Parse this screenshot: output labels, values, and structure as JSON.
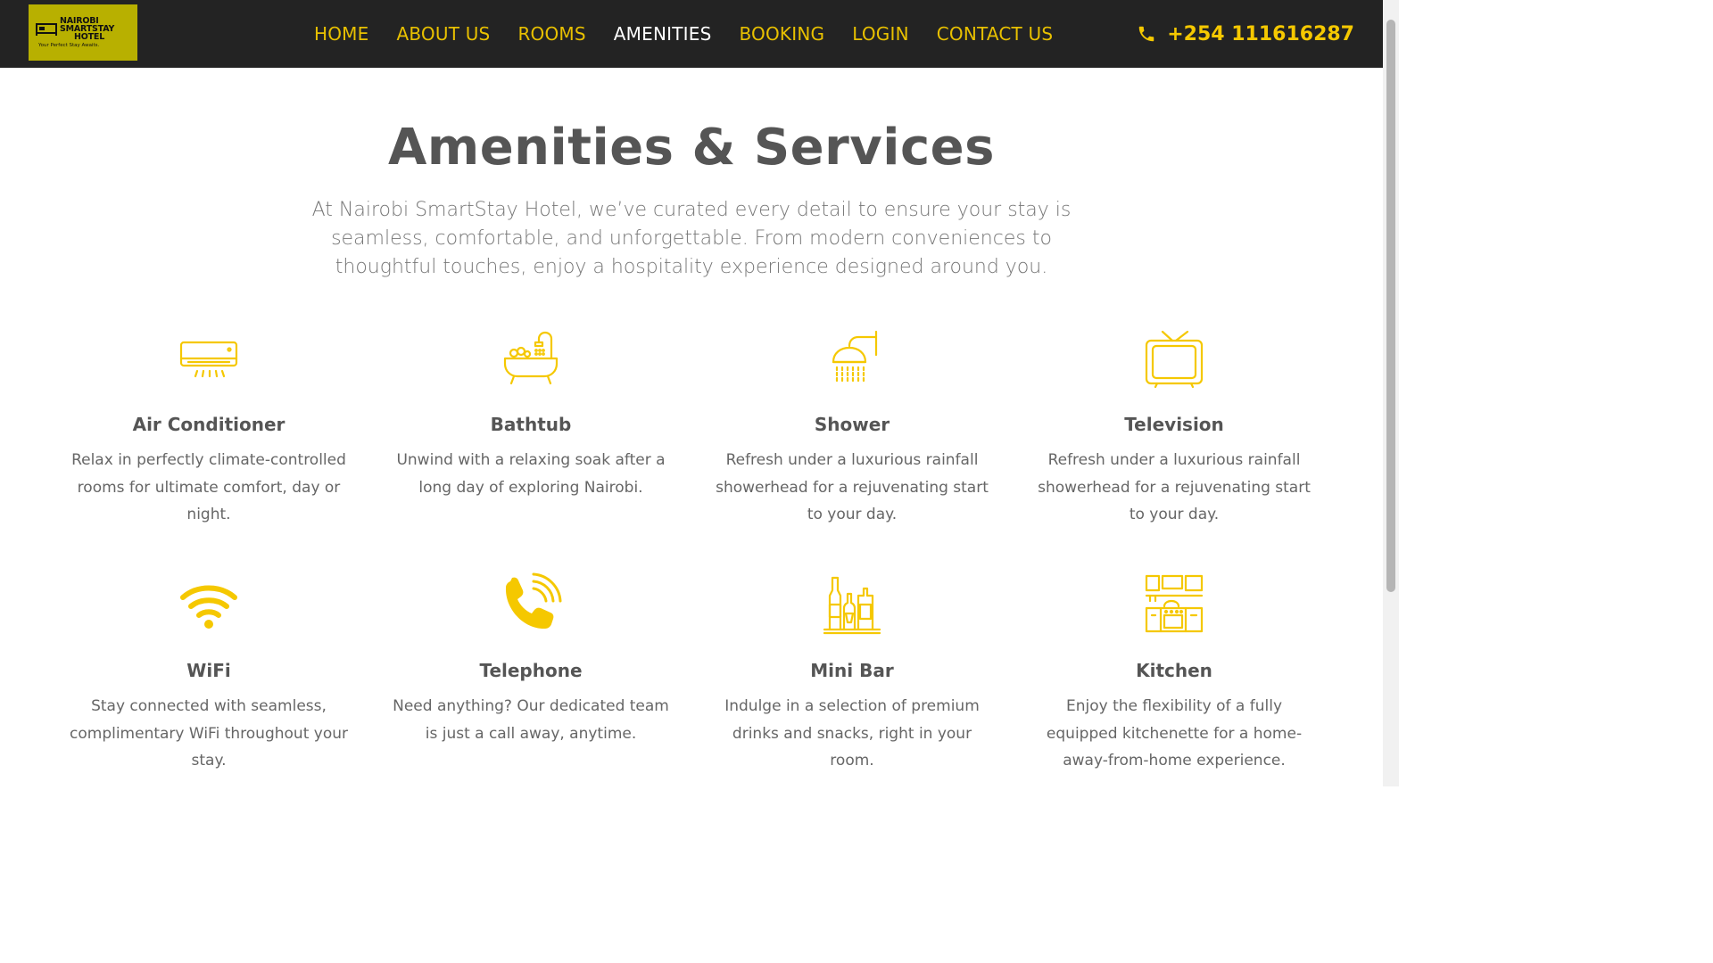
{
  "brand": {
    "line1": "NAIROBI",
    "line2": "SMARTSTAY",
    "line3": "HOTEL",
    "tagline": "Your Perfect Stay Awaits."
  },
  "nav": {
    "items": [
      {
        "label": "HOME"
      },
      {
        "label": "ABOUT US"
      },
      {
        "label": "ROOMS"
      },
      {
        "label": "AMENITIES",
        "active": true
      },
      {
        "label": "BOOKING"
      },
      {
        "label": "LOGIN"
      },
      {
        "label": "CONTACT US"
      }
    ],
    "phone": "+254 111616287"
  },
  "hero": {
    "title": "Amenities & Services",
    "intro": "At Nairobi SmartStay Hotel, we’ve curated every detail to ensure your stay is seamless, comfortable, and unforgettable. From modern conveniences to thoughtful touches, enjoy a hospitality experience designed around you."
  },
  "amenities": [
    {
      "name": "Air Conditioner",
      "icon": "air-conditioner-icon",
      "desc": "Relax in perfectly climate-controlled rooms for ultimate comfort, day or night."
    },
    {
      "name": "Bathtub",
      "icon": "bathtub-icon",
      "desc": "Unwind with a relaxing soak after a long day of exploring Nairobi."
    },
    {
      "name": "Shower",
      "icon": "shower-icon",
      "desc": "Refresh under a luxurious rainfall showerhead for a rejuvenating start to your day."
    },
    {
      "name": "Television",
      "icon": "television-icon",
      "desc": "Refresh under a luxurious rainfall showerhead for a rejuvenating start to your day."
    },
    {
      "name": "WiFi",
      "icon": "wifi-icon",
      "desc": "Stay connected with seamless, complimentary WiFi throughout your stay."
    },
    {
      "name": "Telephone",
      "icon": "telephone-icon",
      "desc": "Need anything? Our dedicated team is just a call away, anytime."
    },
    {
      "name": "Mini Bar",
      "icon": "mini-bar-icon",
      "desc": "Indulge in a selection of premium drinks and snacks, right in your room."
    },
    {
      "name": "Kitchen",
      "icon": "kitchen-icon",
      "desc": "Enjoy the flexibility of a fully equipped kitchenette for a home-away-from-home experience."
    }
  ],
  "colors": {
    "header_bg": "#232323",
    "accent": "#f5c800",
    "logo_bg": "#b8b000",
    "heading": "#555555"
  }
}
